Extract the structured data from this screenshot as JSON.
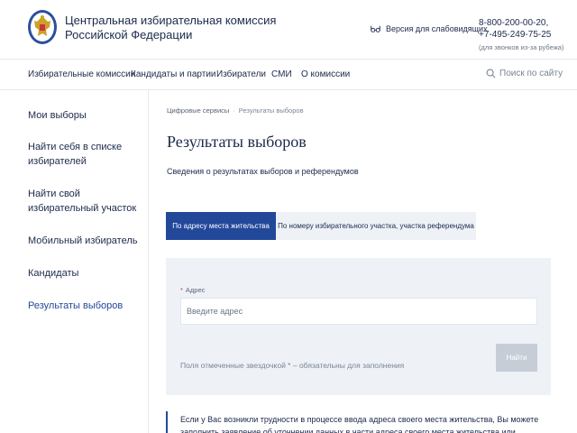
{
  "header": {
    "org_name_line1": "Центральная избирательная комиссия",
    "org_name_line2": "Российской Федерации",
    "vision_label": "Версия для слабовидящих",
    "phone1": "8-800-200-00-20,",
    "phone2": "+7-495-249-75-25",
    "phone_note": "(для звонков из-за рубежа)"
  },
  "nav": {
    "items": [
      {
        "label": "Избирательные комиссии"
      },
      {
        "label": "Кандидаты и партии"
      },
      {
        "label": "Избиратели"
      },
      {
        "label": "СМИ"
      },
      {
        "label": "О комиссии"
      }
    ],
    "search_label": "Поиск по сайту"
  },
  "sidebar": {
    "items": [
      {
        "label": "Мои выборы"
      },
      {
        "label": "Найти себя в списке избирателей"
      },
      {
        "label": "Найти свой избирательный участок"
      },
      {
        "label": "Мобильный избиратель"
      },
      {
        "label": "Кандидаты"
      },
      {
        "label": "Результаты выборов"
      }
    ],
    "active_index": 5
  },
  "main": {
    "breadcrumb": [
      "Цифровые сервисы",
      "Результаты выборов"
    ],
    "title": "Результаты выборов",
    "subtitle": "Сведения о результатах выборов и референдумов",
    "tabs": [
      {
        "label": "По адресу места жительства",
        "active": true
      },
      {
        "label": "По номеру избирательного участка, участка референдума",
        "active": false
      }
    ],
    "form": {
      "required_mark": "*",
      "address_label": "Адрес",
      "address_placeholder": "Введите адрес",
      "address_value": "",
      "required_note": "Поля отмеченные звездочкой * – обязательны для заполнения",
      "submit_label": "Найти"
    },
    "info_text": "Если у Вас возникли трудности в процессе ввода адреса своего места жительства, Вы можете заполнить заявление об уточнении данных в части адреса своего места жительства или обратиться в"
  },
  "colors": {
    "accent": "#22489a",
    "text": "#1b2a4a",
    "panel_bg": "#eef2f7",
    "button_disabled": "#c7cdd7",
    "required_star": "#d0303a"
  },
  "icons": {
    "emblem": "emblem-icon",
    "vision": "glasses-icon",
    "search": "search-icon"
  }
}
